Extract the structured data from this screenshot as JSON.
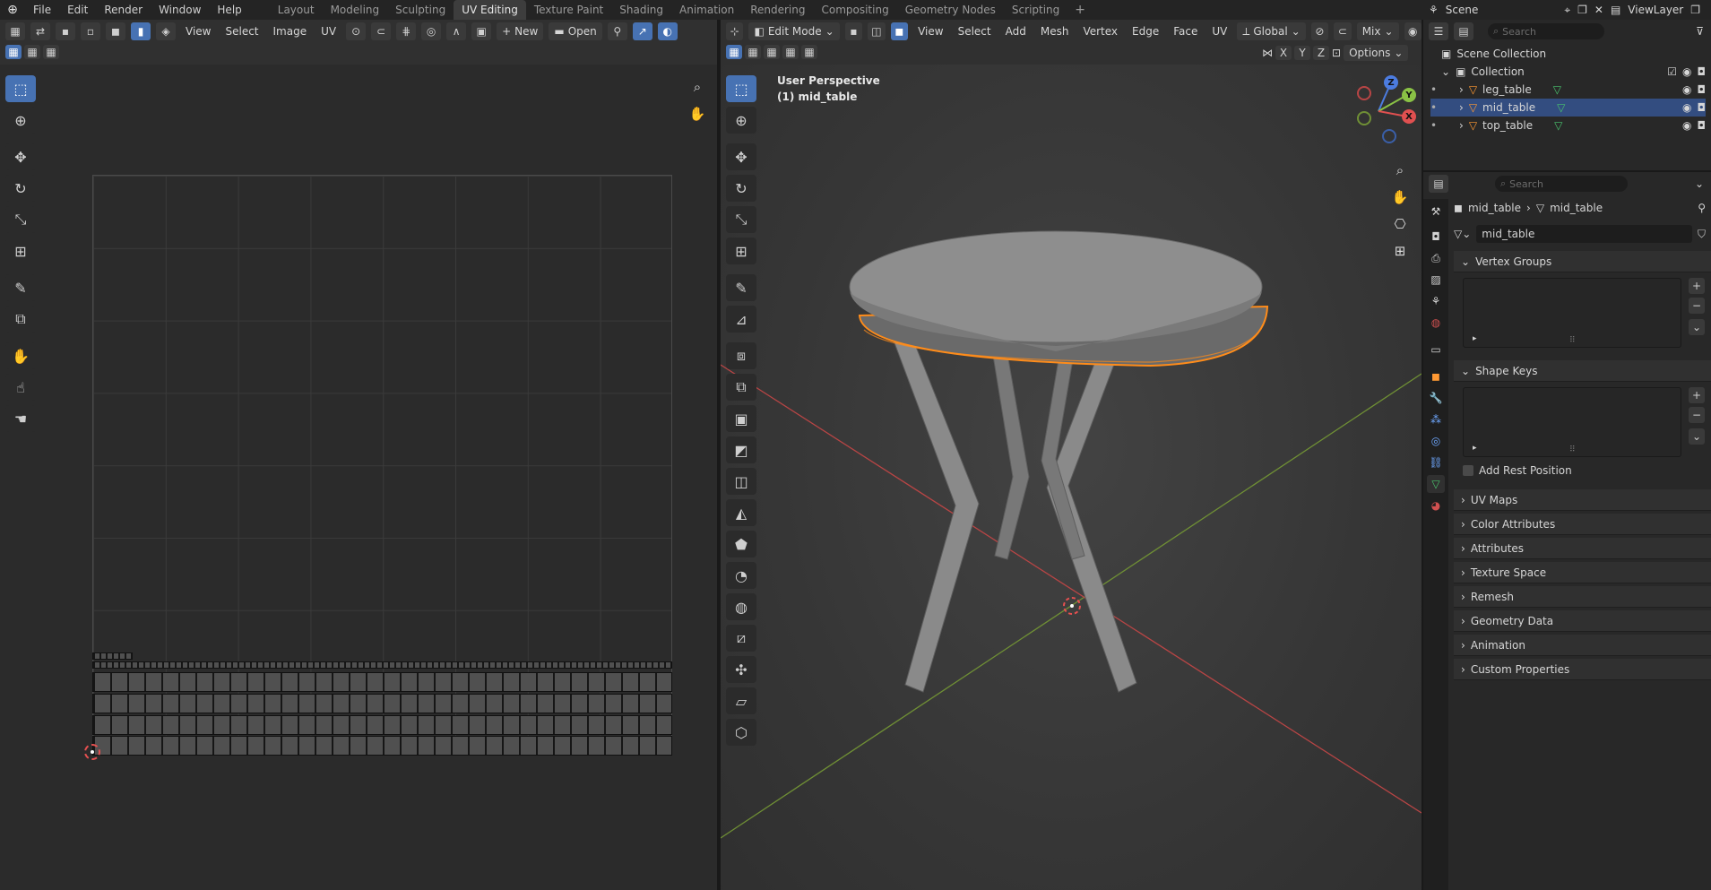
{
  "menu": [
    "File",
    "Edit",
    "Render",
    "Window",
    "Help"
  ],
  "workspaces": [
    {
      "label": "Layout",
      "active": false
    },
    {
      "label": "Modeling",
      "active": false
    },
    {
      "label": "Sculpting",
      "active": false
    },
    {
      "label": "UV Editing",
      "active": true
    },
    {
      "label": "Texture Paint",
      "active": false
    },
    {
      "label": "Shading",
      "active": false
    },
    {
      "label": "Animation",
      "active": false
    },
    {
      "label": "Rendering",
      "active": false
    },
    {
      "label": "Compositing",
      "active": false
    },
    {
      "label": "Geometry Nodes",
      "active": false
    },
    {
      "label": "Scripting",
      "active": false
    }
  ],
  "scene": {
    "label": "Scene"
  },
  "view_layer": {
    "label": "ViewLayer"
  },
  "uv_editor": {
    "menus": [
      "View",
      "Select",
      "Image",
      "UV"
    ],
    "new_label": "New",
    "open_label": "Open"
  },
  "viewport": {
    "mode_label": "Edit Mode",
    "menus": [
      "View",
      "Select",
      "Add",
      "Mesh",
      "Vertex",
      "Edge",
      "Face",
      "UV"
    ],
    "orientation_label": "Global",
    "snap_label": "Mix",
    "options_label": "Options",
    "axes": [
      "X",
      "Y",
      "Z"
    ],
    "perspective_label": "User Perspective",
    "object_label": "(1) mid_table"
  },
  "outliner": {
    "search_placeholder": "Search",
    "scene_collection": "Scene Collection",
    "collection": "Collection",
    "objects": [
      {
        "name": "leg_table",
        "highlighted": false
      },
      {
        "name": "mid_table",
        "highlighted": true
      },
      {
        "name": "top_table",
        "highlighted": false
      }
    ]
  },
  "properties": {
    "search_placeholder": "Search",
    "breadcrumb_object": "mid_table",
    "breadcrumb_mesh": "mid_table",
    "mesh_name": "mid_table",
    "panels": {
      "vertex_groups": "Vertex Groups",
      "shape_keys": "Shape Keys",
      "add_rest_position": "Add Rest Position",
      "uv_maps": "UV Maps",
      "color_attributes": "Color Attributes",
      "attributes": "Attributes",
      "texture_space": "Texture Space",
      "remesh": "Remesh",
      "geometry_data": "Geometry Data",
      "animation": "Animation",
      "custom_properties": "Custom Properties"
    }
  },
  "colors": {
    "accent": "#4772b3",
    "selection_orange": "#ff8c1a",
    "axis_x": "#e05050",
    "axis_y": "#8ac245",
    "axis_z": "#4c7ce0",
    "outliner_highlight": "#334d80",
    "data_green": "#49c36d"
  }
}
